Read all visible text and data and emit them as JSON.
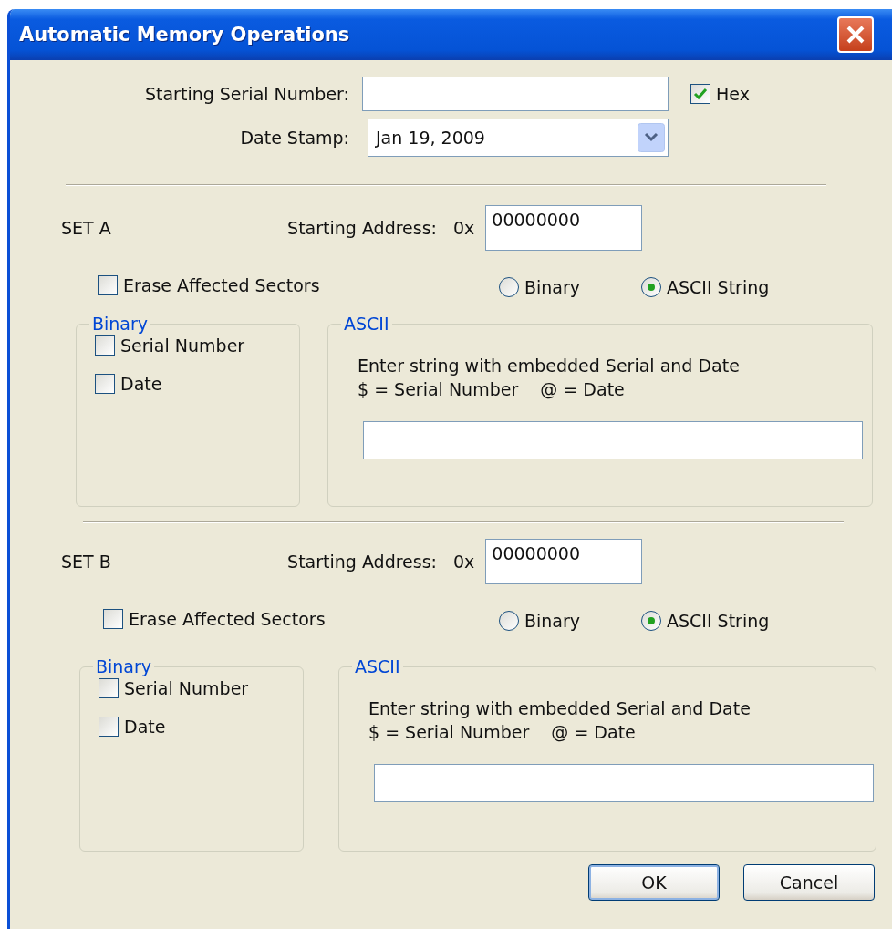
{
  "window": {
    "title": "Automatic Memory Operations"
  },
  "serial": {
    "label": "Starting Serial Number:",
    "hex": {
      "label": "Hex",
      "checked": true
    }
  },
  "date_stamp": {
    "label": "Date Stamp:",
    "value": "Jan 19, 2009"
  },
  "sets": [
    {
      "name": "SET A",
      "address_label": "Starting Address:",
      "prefix": "0x",
      "address": "00000000",
      "erase": {
        "label": "Erase Affected Sectors",
        "checked": false
      },
      "modes": [
        {
          "label": "Binary",
          "selected": false
        },
        {
          "label": "ASCII String",
          "selected": true
        }
      ],
      "binary": {
        "legend": "Binary",
        "options": [
          {
            "label": "Serial Number",
            "checked": false
          },
          {
            "label": "Date",
            "checked": false
          }
        ]
      },
      "ascii": {
        "legend": "ASCII",
        "lines": [
          "Enter string with embedded Serial and Date",
          "$ = Serial Number    @ = Date"
        ]
      }
    },
    {
      "name": "SET B",
      "address_label": "Starting Address:",
      "prefix": "0x",
      "address": "00000000",
      "erase": {
        "label": "Erase Affected Sectors",
        "checked": false
      },
      "modes": [
        {
          "label": "Binary",
          "selected": false
        },
        {
          "label": "ASCII String",
          "selected": true
        }
      ],
      "binary": {
        "legend": "Binary",
        "options": [
          {
            "label": "Serial Number",
            "checked": false
          },
          {
            "label": "Date",
            "checked": false
          }
        ]
      },
      "ascii": {
        "legend": "ASCII",
        "lines": [
          "Enter string with embedded Serial and Date",
          "$ = Serial Number    @ = Date"
        ]
      }
    }
  ],
  "buttons": [
    {
      "label": "OK",
      "default": true
    },
    {
      "label": "Cancel",
      "default": false
    }
  ]
}
